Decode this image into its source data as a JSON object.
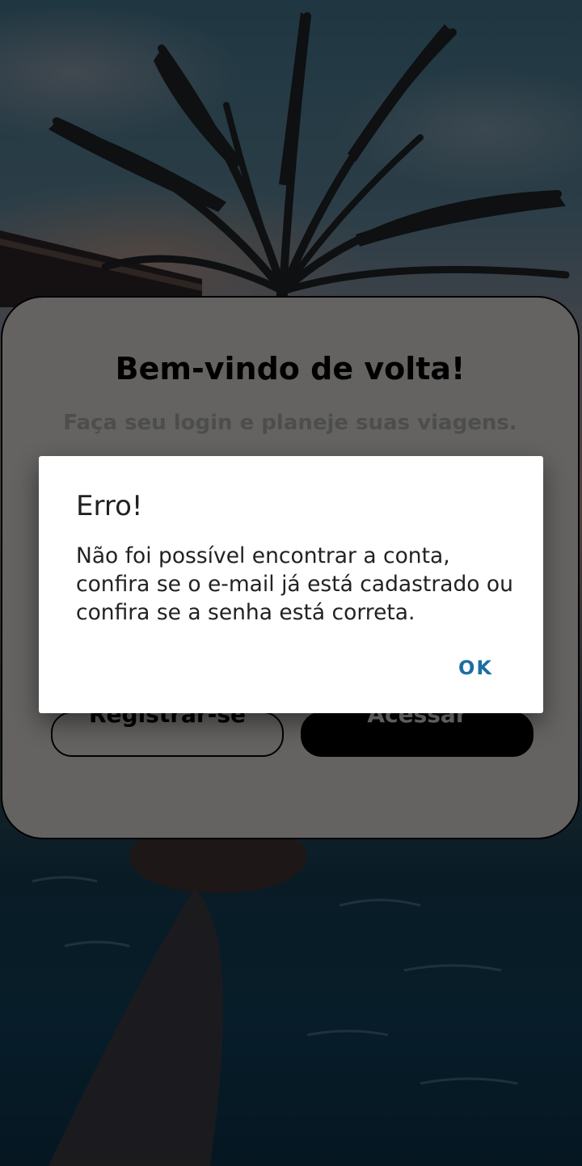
{
  "login": {
    "title": "Bem-vindo de volta!",
    "subtitle": "Faça seu login e planeje suas viagens.",
    "register_label": "Registrar-se",
    "access_label": "Acessar"
  },
  "dialog": {
    "title": "Erro!",
    "message": "Não foi possível encontrar a conta, confira se o e-mail já está cadastrado ou confira se a senha está correta.",
    "ok_label": "OK"
  },
  "colors": {
    "dialog_button": "#1a6fa3",
    "card_background": "#c8c6c3",
    "primary_button": "#000000"
  },
  "background": {
    "scene": "palm-tree-and-pool-photo"
  }
}
